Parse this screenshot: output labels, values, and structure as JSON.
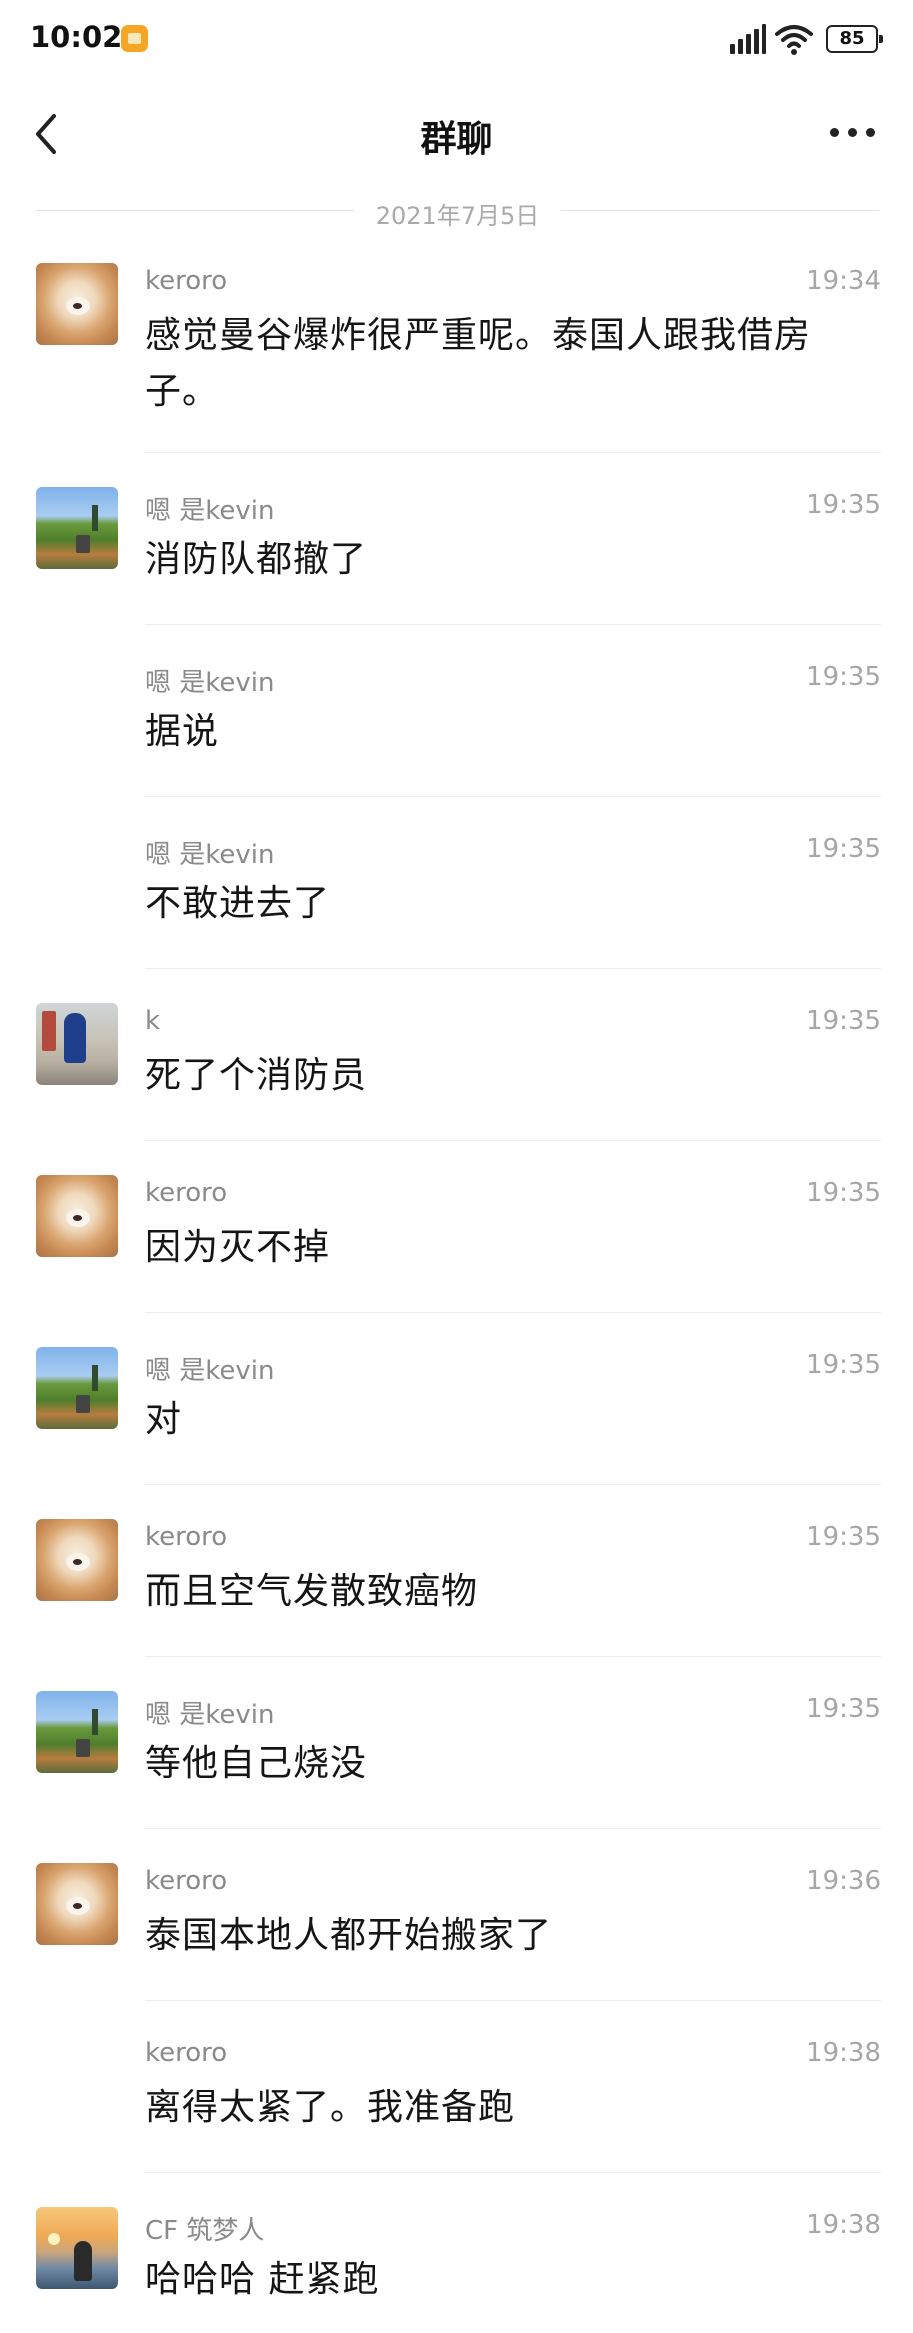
{
  "status_bar": {
    "time": "10:02",
    "battery": "85"
  },
  "header": {
    "title": "群聊"
  },
  "date_divider": "2021年7月5日",
  "messages": [
    {
      "sender": "keroro",
      "time": "19:34",
      "text": "感觉曼谷爆炸很严重呢。泰国人跟我借房子。",
      "avatar": "dog"
    },
    {
      "sender": "嗯 是kevin",
      "time": "19:35",
      "text": "消防队都撤了",
      "avatar": "land"
    },
    {
      "sender": "嗯 是kevin",
      "time": "19:35",
      "text": "据说",
      "avatar": ""
    },
    {
      "sender": "嗯 是kevin",
      "time": "19:35",
      "text": "不敢进去了",
      "avatar": ""
    },
    {
      "sender": "k",
      "time": "19:35",
      "text": "死了个消防员",
      "avatar": "kaws"
    },
    {
      "sender": "keroro",
      "time": "19:35",
      "text": "因为灭不掉",
      "avatar": "dog"
    },
    {
      "sender": "嗯 是kevin",
      "time": "19:35",
      "text": "对",
      "avatar": "land"
    },
    {
      "sender": "keroro",
      "time": "19:35",
      "text": "而且空气发散致癌物",
      "avatar": "dog"
    },
    {
      "sender": "嗯 是kevin",
      "time": "19:35",
      "text": "等他自己烧没",
      "avatar": "land"
    },
    {
      "sender": "keroro",
      "time": "19:36",
      "text": "泰国本地人都开始搬家了",
      "avatar": "dog"
    },
    {
      "sender": "keroro",
      "time": "19:38",
      "text": "离得太紧了。我准备跑",
      "avatar": ""
    },
    {
      "sender": "CF 筑梦人",
      "time": "19:38",
      "text": "哈哈哈 赶紧跑",
      "avatar": "sunset"
    }
  ]
}
